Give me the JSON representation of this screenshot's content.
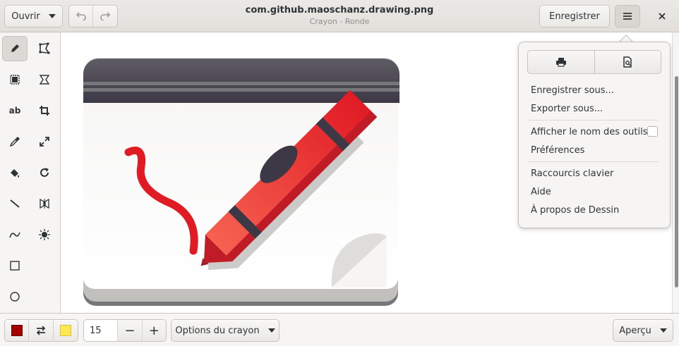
{
  "header": {
    "open_label": "Ouvrir",
    "title": "com.github.maoschanz.drawing.png",
    "subtitle": "Crayon - Ronde",
    "save_label": "Enregistrer"
  },
  "menu": {
    "save_as": "Enregistrer sous...",
    "export_as": "Exporter sous...",
    "show_tool_names": "Afficher le nom des outils",
    "preferences": "Préférences",
    "shortcuts": "Raccourcis clavier",
    "help": "Aide",
    "about": "À propos de Dessin"
  },
  "tools": [
    "pencil",
    "free-select",
    "rect-select",
    "free-transform",
    "text",
    "crop",
    "color-picker",
    "scale",
    "paint-bucket",
    "rotate",
    "line",
    "flip",
    "curve",
    "filters",
    "rectangle",
    "circle"
  ],
  "bottom": {
    "size_value": "15",
    "minus_label": "−",
    "plus_label": "+",
    "options_label": "Options du crayon",
    "preview_label": "Aperçu"
  },
  "colors": {
    "main_color": "#a40000",
    "secondary_color": "#fce94f",
    "accent": "#e01b24"
  }
}
